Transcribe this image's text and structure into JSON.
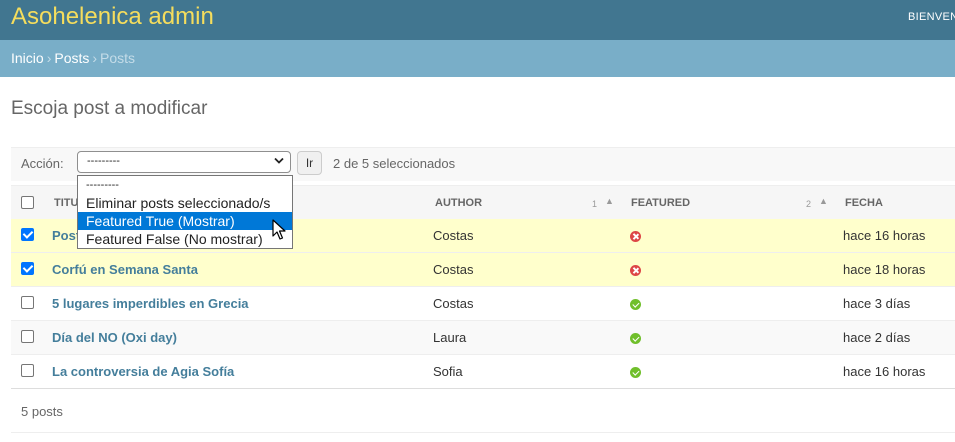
{
  "header": {
    "site_title": "Asohelenica admin",
    "welcome": "BIENVEN"
  },
  "breadcrumbs": {
    "home": "Inicio",
    "app": "Posts",
    "current": "Posts",
    "separator": "›"
  },
  "page_title": "Escoja post a modificar",
  "actions": {
    "label": "Acción:",
    "selected_value": "---------",
    "go_label": "Ir",
    "counter": "2 de 5 seleccionados",
    "options": [
      "---------",
      "Eliminar posts seleccionado/s",
      "Featured True (Mostrar)",
      "Featured False (No mostrar)"
    ],
    "highlighted_option_index": 2
  },
  "table": {
    "columns": {
      "title": "TITULO",
      "author": "AUTHOR",
      "featured": "FEATURED",
      "fecha": "FECHA"
    },
    "sort": {
      "author_priority": "1",
      "featured_priority": "2",
      "arrow": "▲"
    },
    "rows": [
      {
        "title": "Post",
        "author": "Costas",
        "featured": false,
        "fecha": "hace 16 horas",
        "selected": true
      },
      {
        "title": "Corfú en Semana Santa",
        "author": "Costas",
        "featured": false,
        "fecha": "hace 18 horas",
        "selected": true
      },
      {
        "title": "5 lugares imperdibles en Grecia",
        "author": "Costas",
        "featured": true,
        "fecha": "hace 3 días",
        "selected": false
      },
      {
        "title": "Día del NO (Oxi day)",
        "author": "Laura",
        "featured": true,
        "fecha": "hace 2 días",
        "selected": false
      },
      {
        "title": "La controversia de Agia Sofía",
        "author": "Sofia",
        "featured": true,
        "fecha": "hace 16 horas",
        "selected": false
      }
    ]
  },
  "paginator": "5 posts",
  "colors": {
    "header_bg": "#417690",
    "title_yellow": "#f5dd5d",
    "breadcrumb_bg": "#79aec8",
    "selected_row": "#ffffcc",
    "link": "#447e9b",
    "highlight": "#0078d7"
  },
  "icons": {
    "featured_no": "icon-no",
    "featured_yes": "icon-yes",
    "pointer": "mouse-cursor-icon"
  }
}
